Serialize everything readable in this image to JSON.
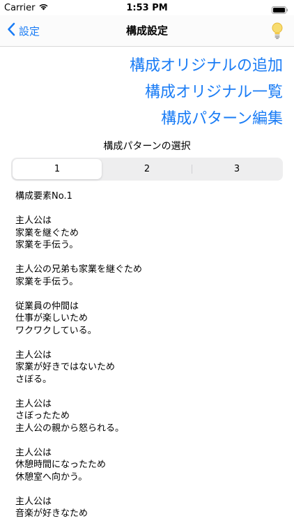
{
  "status_bar": {
    "carrier": "Carrier",
    "time": "1:53 PM"
  },
  "nav": {
    "back_label": "設定",
    "title": "構成設定"
  },
  "links": [
    {
      "label": "構成オリジナルの追加"
    },
    {
      "label": "構成オリジナル一覧"
    },
    {
      "label": "構成パターン編集"
    }
  ],
  "pattern_select_label": "構成パターンの選択",
  "segments": [
    {
      "label": "1",
      "selected": true
    },
    {
      "label": "2",
      "selected": false
    },
    {
      "label": "3",
      "selected": false
    }
  ],
  "content": {
    "heading": "構成要素No.1",
    "elements": [
      {
        "lines": [
          "主人公は",
          "家業を継ぐため",
          "家業を手伝う。"
        ]
      },
      {
        "lines": [
          "主人公の兄弟も家業を継ぐため",
          "家業を手伝う。"
        ]
      },
      {
        "lines": [
          "従業員の仲間は",
          "仕事が楽しいため",
          "ワクワクしている。"
        ]
      },
      {
        "lines": [
          "主人公は",
          "家業が好きではないため",
          "さぼる。"
        ]
      },
      {
        "lines": [
          "主人公は",
          "さぼったため",
          "主人公の親から怒られる。"
        ]
      },
      {
        "lines": [
          "主人公は",
          "休憩時間になったため",
          "休憩室へ向かう。"
        ]
      },
      {
        "lines": [
          "主人公は",
          "音楽が好きなため"
        ]
      }
    ]
  },
  "colors": {
    "accent": "#1a7cf5",
    "bulb": "#f2c94c"
  },
  "icons": {
    "wifi": "wifi-icon",
    "battery": "battery-icon",
    "back": "chevron-left-icon",
    "bulb": "lightbulb-icon"
  }
}
